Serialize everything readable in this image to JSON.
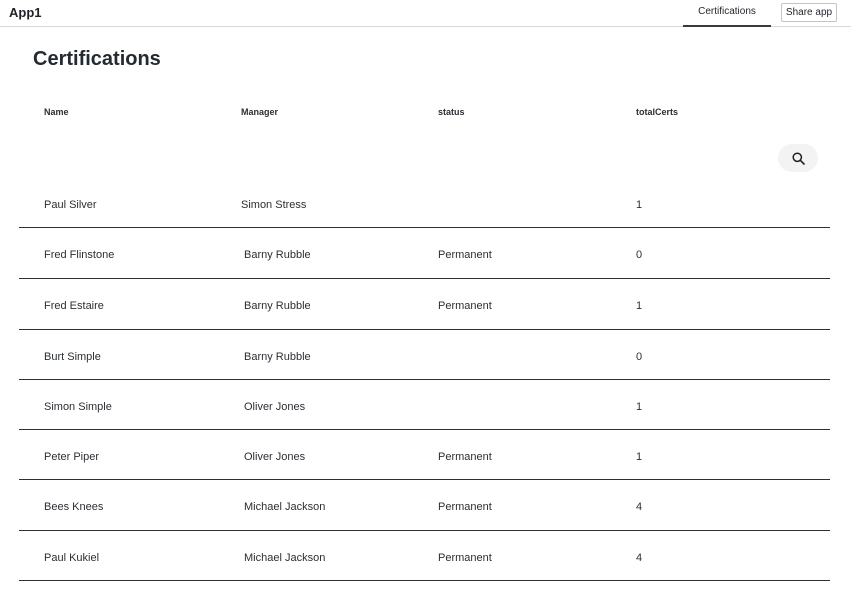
{
  "app": {
    "title": "App1"
  },
  "nav": {
    "tabs": [
      {
        "label": "Certifications",
        "active": true
      }
    ],
    "share_label": "Share app"
  },
  "page": {
    "title": "Certifications"
  },
  "table": {
    "columns": [
      "Name",
      "Manager",
      "status",
      "totalCerts"
    ],
    "search_icon": "search-icon",
    "rows": [
      {
        "name": "Paul Silver",
        "manager": "Simon Stress",
        "status": "",
        "totalCerts": "1"
      },
      {
        "name": "Fred Flinstone",
        "manager": "Barny Rubble",
        "status": "Permanent",
        "totalCerts": "0"
      },
      {
        "name": "Fred Estaire",
        "manager": "Barny Rubble",
        "status": "Permanent",
        "totalCerts": "1"
      },
      {
        "name": "Burt Simple",
        "manager": "Barny Rubble",
        "status": "",
        "totalCerts": "0"
      },
      {
        "name": "Simon Simple",
        "manager": "Oliver Jones",
        "status": "",
        "totalCerts": "1"
      },
      {
        "name": "Peter Piper",
        "manager": "Oliver Jones",
        "status": "Permanent",
        "totalCerts": "1"
      },
      {
        "name": "Bees Knees",
        "manager": "Michael Jackson",
        "status": "Permanent",
        "totalCerts": "4"
      },
      {
        "name": "Paul Kukiel",
        "manager": "Michael Jackson",
        "status": "Permanent",
        "totalCerts": "4"
      }
    ]
  },
  "colors": {
    "text": "#1f2328",
    "divider": "#2f2f2f",
    "search_bg": "#f3f3f3"
  }
}
